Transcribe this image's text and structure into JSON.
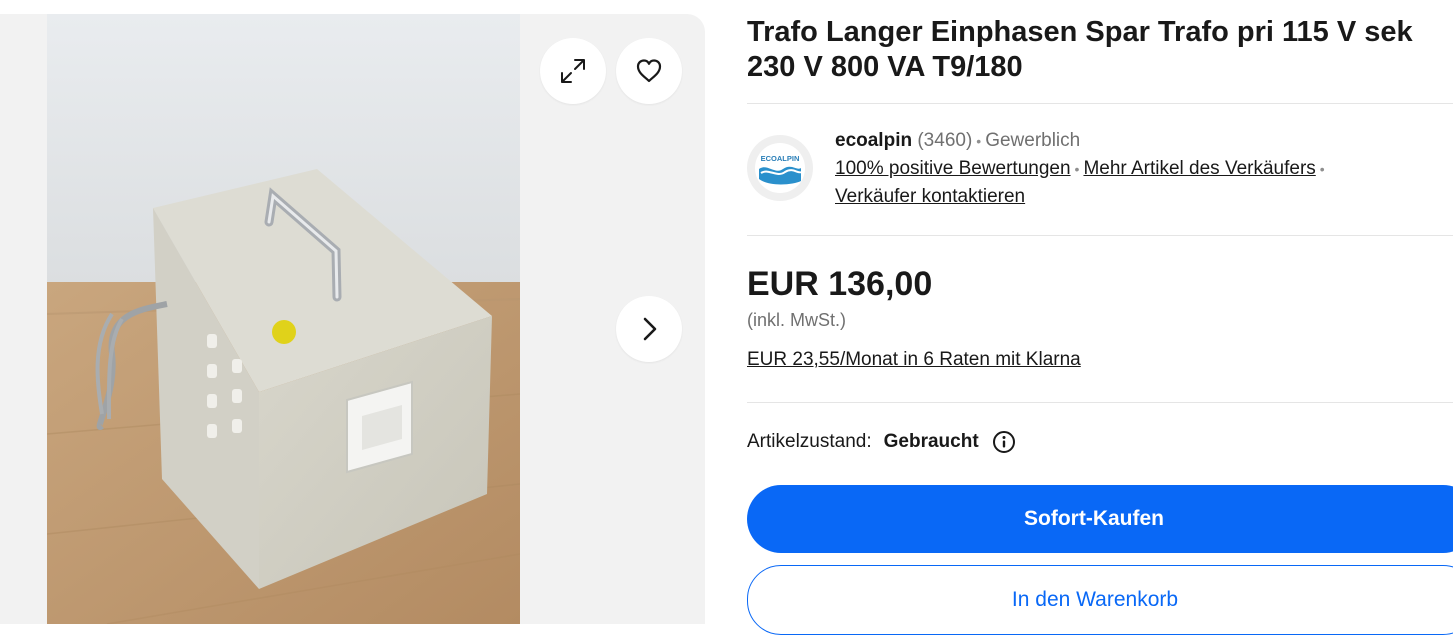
{
  "listing": {
    "title": "Trafo Langer Einphasen Spar Trafo pri 115 V sek 230 V 800 VA T9/180"
  },
  "gallery": {
    "expand_icon": "expand-arrows-icon",
    "watch_icon": "heart-icon",
    "next_icon": "chevron-right-icon"
  },
  "seller": {
    "logo_text": "ECOALPIN",
    "name": "ecoalpin",
    "rating_count": "(3460)",
    "separator": "•",
    "type": "Gewerblich",
    "feedback_link": "100% positive Bewertungen",
    "more_items_link": "Mehr Artikel des Verkäufers",
    "contact_link": "Verkäufer kontaktieren"
  },
  "pricing": {
    "price": "EUR 136,00",
    "tax_note": "(inkl. MwSt.)",
    "installment_link": "EUR 23,55/Monat in 6 Raten mit Klarna"
  },
  "condition": {
    "label": "Artikelzustand:",
    "value": "Gebraucht",
    "info_icon": "info-circle-icon"
  },
  "actions": {
    "buy_now": "Sofort-Kaufen",
    "add_to_cart": "In den Warenkorb"
  },
  "colors": {
    "primary_blue": "#0968f6",
    "text_dark": "#191919",
    "text_grey": "#707070",
    "gallery_bg": "#f2f2f2"
  }
}
